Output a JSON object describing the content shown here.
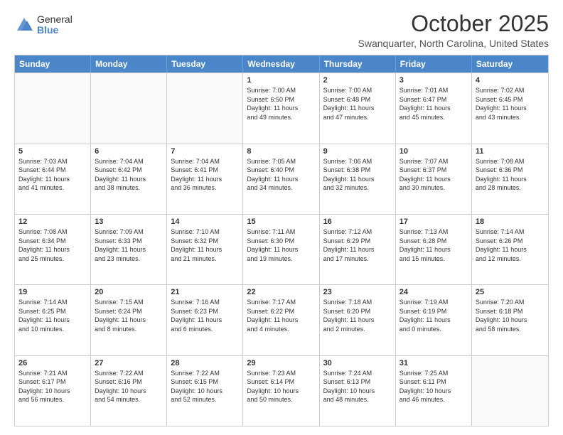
{
  "logo": {
    "general": "General",
    "blue": "Blue"
  },
  "title": "October 2025",
  "location": "Swanquarter, North Carolina, United States",
  "days_of_week": [
    "Sunday",
    "Monday",
    "Tuesday",
    "Wednesday",
    "Thursday",
    "Friday",
    "Saturday"
  ],
  "weeks": [
    [
      {
        "day": "",
        "info": ""
      },
      {
        "day": "",
        "info": ""
      },
      {
        "day": "",
        "info": ""
      },
      {
        "day": "1",
        "info": "Sunrise: 7:00 AM\nSunset: 6:50 PM\nDaylight: 11 hours\nand 49 minutes."
      },
      {
        "day": "2",
        "info": "Sunrise: 7:00 AM\nSunset: 6:48 PM\nDaylight: 11 hours\nand 47 minutes."
      },
      {
        "day": "3",
        "info": "Sunrise: 7:01 AM\nSunset: 6:47 PM\nDaylight: 11 hours\nand 45 minutes."
      },
      {
        "day": "4",
        "info": "Sunrise: 7:02 AM\nSunset: 6:45 PM\nDaylight: 11 hours\nand 43 minutes."
      }
    ],
    [
      {
        "day": "5",
        "info": "Sunrise: 7:03 AM\nSunset: 6:44 PM\nDaylight: 11 hours\nand 41 minutes."
      },
      {
        "day": "6",
        "info": "Sunrise: 7:04 AM\nSunset: 6:42 PM\nDaylight: 11 hours\nand 38 minutes."
      },
      {
        "day": "7",
        "info": "Sunrise: 7:04 AM\nSunset: 6:41 PM\nDaylight: 11 hours\nand 36 minutes."
      },
      {
        "day": "8",
        "info": "Sunrise: 7:05 AM\nSunset: 6:40 PM\nDaylight: 11 hours\nand 34 minutes."
      },
      {
        "day": "9",
        "info": "Sunrise: 7:06 AM\nSunset: 6:38 PM\nDaylight: 11 hours\nand 32 minutes."
      },
      {
        "day": "10",
        "info": "Sunrise: 7:07 AM\nSunset: 6:37 PM\nDaylight: 11 hours\nand 30 minutes."
      },
      {
        "day": "11",
        "info": "Sunrise: 7:08 AM\nSunset: 6:36 PM\nDaylight: 11 hours\nand 28 minutes."
      }
    ],
    [
      {
        "day": "12",
        "info": "Sunrise: 7:08 AM\nSunset: 6:34 PM\nDaylight: 11 hours\nand 25 minutes."
      },
      {
        "day": "13",
        "info": "Sunrise: 7:09 AM\nSunset: 6:33 PM\nDaylight: 11 hours\nand 23 minutes."
      },
      {
        "day": "14",
        "info": "Sunrise: 7:10 AM\nSunset: 6:32 PM\nDaylight: 11 hours\nand 21 minutes."
      },
      {
        "day": "15",
        "info": "Sunrise: 7:11 AM\nSunset: 6:30 PM\nDaylight: 11 hours\nand 19 minutes."
      },
      {
        "day": "16",
        "info": "Sunrise: 7:12 AM\nSunset: 6:29 PM\nDaylight: 11 hours\nand 17 minutes."
      },
      {
        "day": "17",
        "info": "Sunrise: 7:13 AM\nSunset: 6:28 PM\nDaylight: 11 hours\nand 15 minutes."
      },
      {
        "day": "18",
        "info": "Sunrise: 7:14 AM\nSunset: 6:26 PM\nDaylight: 11 hours\nand 12 minutes."
      }
    ],
    [
      {
        "day": "19",
        "info": "Sunrise: 7:14 AM\nSunset: 6:25 PM\nDaylight: 11 hours\nand 10 minutes."
      },
      {
        "day": "20",
        "info": "Sunrise: 7:15 AM\nSunset: 6:24 PM\nDaylight: 11 hours\nand 8 minutes."
      },
      {
        "day": "21",
        "info": "Sunrise: 7:16 AM\nSunset: 6:23 PM\nDaylight: 11 hours\nand 6 minutes."
      },
      {
        "day": "22",
        "info": "Sunrise: 7:17 AM\nSunset: 6:22 PM\nDaylight: 11 hours\nand 4 minutes."
      },
      {
        "day": "23",
        "info": "Sunrise: 7:18 AM\nSunset: 6:20 PM\nDaylight: 11 hours\nand 2 minutes."
      },
      {
        "day": "24",
        "info": "Sunrise: 7:19 AM\nSunset: 6:19 PM\nDaylight: 11 hours\nand 0 minutes."
      },
      {
        "day": "25",
        "info": "Sunrise: 7:20 AM\nSunset: 6:18 PM\nDaylight: 10 hours\nand 58 minutes."
      }
    ],
    [
      {
        "day": "26",
        "info": "Sunrise: 7:21 AM\nSunset: 6:17 PM\nDaylight: 10 hours\nand 56 minutes."
      },
      {
        "day": "27",
        "info": "Sunrise: 7:22 AM\nSunset: 6:16 PM\nDaylight: 10 hours\nand 54 minutes."
      },
      {
        "day": "28",
        "info": "Sunrise: 7:22 AM\nSunset: 6:15 PM\nDaylight: 10 hours\nand 52 minutes."
      },
      {
        "day": "29",
        "info": "Sunrise: 7:23 AM\nSunset: 6:14 PM\nDaylight: 10 hours\nand 50 minutes."
      },
      {
        "day": "30",
        "info": "Sunrise: 7:24 AM\nSunset: 6:13 PM\nDaylight: 10 hours\nand 48 minutes."
      },
      {
        "day": "31",
        "info": "Sunrise: 7:25 AM\nSunset: 6:11 PM\nDaylight: 10 hours\nand 46 minutes."
      },
      {
        "day": "",
        "info": ""
      }
    ]
  ]
}
